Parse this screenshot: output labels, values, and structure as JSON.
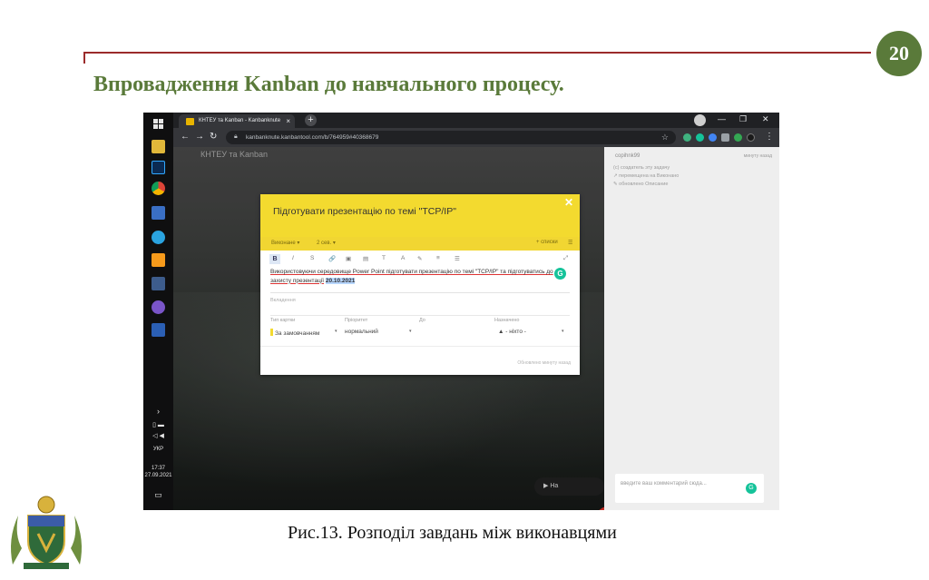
{
  "slide": {
    "page_number": "20",
    "title": "Впровадження Kanban до навчального процесу.",
    "caption": "Рис.13. Розподіл завдань між виконавцями"
  },
  "colors": {
    "title": "#5a7a3a",
    "rule": "#9b2b2b",
    "card_header": "#f3da2f",
    "badge": "#5a7a3a"
  },
  "screenshot": {
    "taskbar": {
      "icons": [
        "windows-start-icon",
        "file-explorer-icon",
        "photoshop-icon",
        "chrome-icon",
        "save-icon",
        "telegram-icon",
        "sublime-icon",
        "app-icon",
        "viber-icon",
        "word-icon"
      ],
      "language": "УКР",
      "time": "17:37",
      "date": "27.09.2021"
    },
    "browser": {
      "tab_title": "КНТЕУ та Kanban - Kanbanknute",
      "url": "kanbanknute.kanbantool.com/b/764959#40368679"
    },
    "board": {
      "title": "КНТЕУ та Kanban",
      "chat_label": "На"
    },
    "card": {
      "title": "Підготувати презентацію по темі \"TCP/IP\"",
      "status": "Виконане",
      "subtasks": "2 сев.",
      "lists": "списки",
      "toolbar": [
        "B",
        "I",
        "S",
        "🔗",
        "▣",
        "▤",
        "T",
        "A",
        "✎",
        "≡",
        "☰"
      ],
      "description_part1": "Використовуючи середовище Power Point підготувати презентацію по темі \"TCP/IP\" та підготуватись до захисту презентації",
      "description_date": "20.10.2021",
      "attachments_label": "Вкладення",
      "fields": {
        "type_label": "Тип картки",
        "type_value": "За замовчанням",
        "priority_label": "Пріоритет",
        "priority_value": "нормальний",
        "due_label": "До",
        "due_value": "",
        "assigned_label": "Назначено",
        "assigned_value": "- ніхто -"
      },
      "footer_note": "Обновлено минуту назад"
    },
    "side_panel": {
      "user": "copihnk99",
      "time_hint": "минуту назад",
      "activity": [
        "(с) создатель эту задачу",
        "↗ перемещена на Виконано",
        "✎ обновлено Описание"
      ],
      "comment_placeholder": "введите ваш комментарий сюда..."
    }
  }
}
